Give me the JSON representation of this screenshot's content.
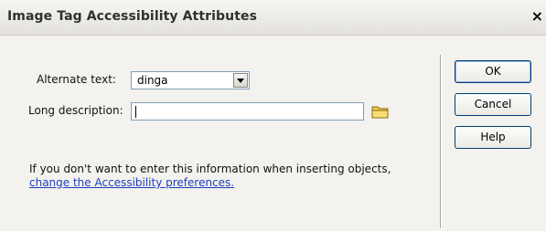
{
  "dialog": {
    "title": "Image Tag Accessibility Attributes",
    "close_label": "×"
  },
  "form": {
    "alt_text_label": "Alternate text:",
    "alt_text_value": "dinga",
    "long_desc_label": "Long description:",
    "long_desc_value": ""
  },
  "info": {
    "text": "If you don't want to enter this information when inserting objects,",
    "link": "change the Accessibility preferences."
  },
  "buttons": {
    "ok": "OK",
    "cancel": "Cancel",
    "help": "Help"
  },
  "icons": {
    "folder": "folder-icon",
    "dropdown": "chevron-down-icon"
  },
  "colors": {
    "link": "#1f3fbf",
    "folder": "#f2c84b"
  }
}
